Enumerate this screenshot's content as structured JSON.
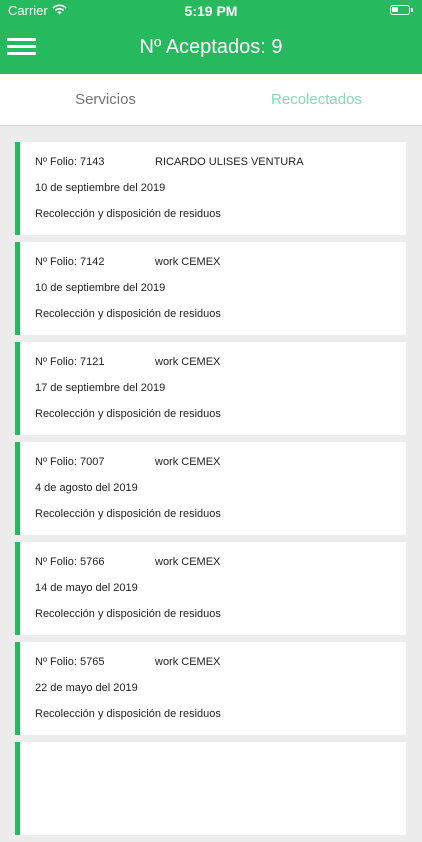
{
  "status_bar": {
    "carrier": "Carrier",
    "time": "5:19 PM"
  },
  "header": {
    "title": "Nº Aceptados: 9"
  },
  "tabs": [
    {
      "label": "Servicios",
      "active": false
    },
    {
      "label": "Recolectados",
      "active": true
    }
  ],
  "colors": {
    "brand": "#27b95e",
    "active_tab": "#86dab3",
    "inactive_tab": "#757575",
    "background": "#ececec"
  },
  "icons": {
    "menu": "hamburger-menu-icon",
    "wifi": "wifi-icon",
    "battery": "battery-icon"
  },
  "records": [
    {
      "folio": "Nº Folio: 7143",
      "client": "RICARDO ULISES VENTURA",
      "date": "10 de septiembre del 2019",
      "service": "Recolección y disposición de residuos"
    },
    {
      "folio": "Nº Folio: 7142",
      "client": "work CEMEX",
      "date": "10 de septiembre del 2019",
      "service": "Recolección y disposición de residuos"
    },
    {
      "folio": "Nº Folio: 7121",
      "client": "work CEMEX",
      "date": "17 de septiembre del 2019",
      "service": "Recolección y disposición de residuos"
    },
    {
      "folio": "Nº Folio: 7007",
      "client": "work CEMEX",
      "date": "4 de agosto del 2019",
      "service": "Recolección y disposición de residuos"
    },
    {
      "folio": "Nº Folio: 5766",
      "client": "work CEMEX",
      "date": "14 de mayo del 2019",
      "service": "Recolección y disposición de residuos"
    },
    {
      "folio": "Nº Folio: 5765",
      "client": "work CEMEX",
      "date": "22 de mayo del 2019",
      "service": "Recolección y disposición de residuos"
    },
    {
      "folio": "",
      "client": "",
      "date": "",
      "service": ""
    }
  ]
}
